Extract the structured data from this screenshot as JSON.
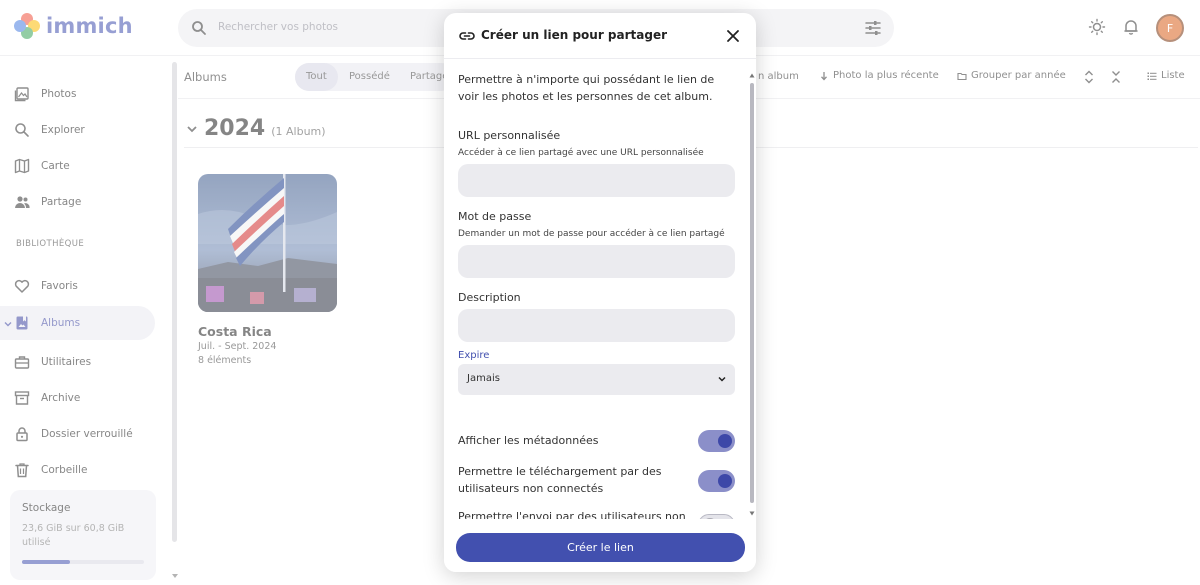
{
  "app": {
    "name": "immich"
  },
  "search": {
    "placeholder": "Rechercher vos photos"
  },
  "user": {
    "initial": "F"
  },
  "sidebar": {
    "items": [
      {
        "label": "Photos"
      },
      {
        "label": "Explorer"
      },
      {
        "label": "Carte"
      },
      {
        "label": "Partage"
      },
      {
        "label": "Favoris"
      },
      {
        "label": "Albums"
      },
      {
        "label": "Utilitaires"
      },
      {
        "label": "Archive"
      },
      {
        "label": "Dossier verrouillé"
      },
      {
        "label": "Corbeille"
      }
    ],
    "section_label": "BIBLIOTHÈQUE",
    "storage": {
      "title": "Stockage",
      "text": "23,6 GiB sur 60,8 GiB utilisé",
      "used_fraction": 0.39
    }
  },
  "toolbar": {
    "title": "Albums",
    "tabs": [
      "Tout",
      "Possédé",
      "Partagé"
    ],
    "active_tab": "Tout",
    "actions": {
      "new_album": "n album",
      "sort": "Photo la plus récente",
      "group": "Grouper par année",
      "view": "Liste"
    }
  },
  "year_group": {
    "year": "2024",
    "count": "(1 Album)"
  },
  "album": {
    "name": "Costa Rica",
    "date": "Juil. - Sept. 2024",
    "count": "8 éléments"
  },
  "modal": {
    "title": "Créer un lien pour partager",
    "intro": "Permettre à n'importe qui possédant le lien de voir les photos et les personnes de cet album.",
    "custom_url_label": "URL personnalisée",
    "custom_url_hint": "Accéder à ce lien partagé avec une URL personnalisée",
    "password_label": "Mot de passe",
    "password_hint": "Demander un mot de passe pour accéder à ce lien partagé",
    "description_label": "Description",
    "expire_label": "Expire",
    "expire_value": "Jamais",
    "toggles": [
      {
        "label": "Afficher les métadonnées",
        "on": true
      },
      {
        "label": "Permettre le téléchargement par des utilisateurs non connectés",
        "on": true
      },
      {
        "label": "Permettre l'envoi par des utilisateurs non connectés",
        "on": false
      }
    ],
    "submit": "Créer le lien"
  },
  "colors": {
    "accent": "#4250af",
    "avatar": "#d9621e"
  }
}
